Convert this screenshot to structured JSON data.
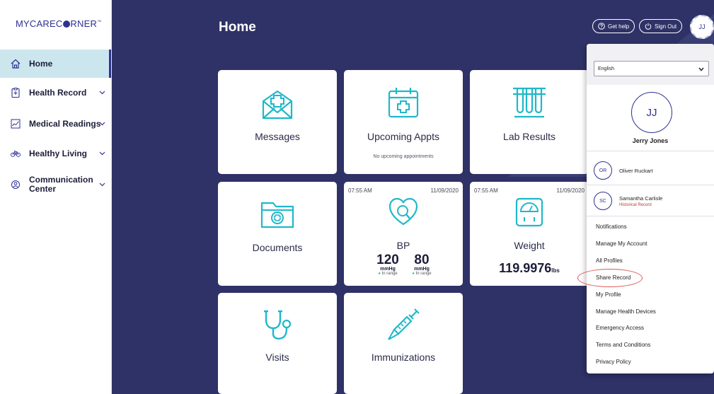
{
  "brand": {
    "logo_text_a": "MYCAREC",
    "logo_text_b": "RNER",
    "logo_mark": "™"
  },
  "sidebar": {
    "items": [
      {
        "label": "Home",
        "icon": "home-icon"
      },
      {
        "label": "Health Record",
        "icon": "clipboard-icon"
      },
      {
        "label": "Medical Readings",
        "icon": "chart-icon"
      },
      {
        "label": "Healthy Living",
        "icon": "bike-icon"
      },
      {
        "label": "Communication Center",
        "icon": "chat-icon"
      }
    ]
  },
  "header": {
    "title": "Home",
    "help_label": "Get help",
    "signout_label": "Sign Out",
    "avatar_initials": "JJ"
  },
  "cards": {
    "messages": {
      "title": "Messages"
    },
    "appts": {
      "title": "Upcoming Appts",
      "subtitle": "No upcoming appointments"
    },
    "lab": {
      "title": "Lab Results"
    },
    "documents": {
      "title": "Documents"
    },
    "bp": {
      "time": "07:55 AM",
      "date": "11/09/2020",
      "title": "BP",
      "systolic": "120",
      "diastolic": "80",
      "unit": "mmHg",
      "status": "In range"
    },
    "weight": {
      "time": "07:55 AM",
      "date": "11/09/2020",
      "title": "Weight",
      "value": "119.9976",
      "unit": "lbs"
    },
    "visits": {
      "title": "Visits"
    },
    "immunizations": {
      "title": "Immunizations"
    }
  },
  "dropdown": {
    "language": "English",
    "avatar_initials": "JJ",
    "user_name": "Jerry Jones",
    "profiles": [
      {
        "initials": "OR",
        "name": "Oliver Ruckart",
        "tag": ""
      },
      {
        "initials": "SC",
        "name": "Samantha Carlisle",
        "tag": "Historical Record"
      }
    ],
    "menu": [
      "Notifications",
      "Manage My Account",
      "All Profiles",
      "Share Record",
      "My Profile",
      "Manage Health Devices",
      "Emergency Access",
      "Terms and Conditions",
      "Privacy Policy"
    ]
  },
  "colors": {
    "brand": "#2e3192",
    "main_bg": "#2e3266",
    "accent_teal": "#1fb8c9",
    "sidebar_active": "#cce6ee",
    "in_range": "#2ecc71"
  }
}
